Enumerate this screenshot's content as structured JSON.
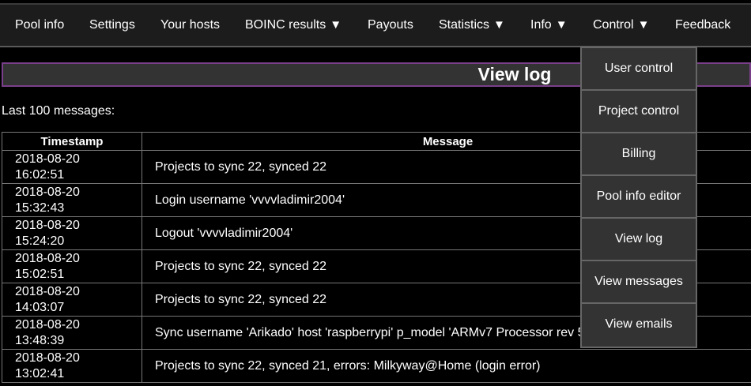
{
  "nav": {
    "items": [
      {
        "label": "Pool info",
        "arrow": ""
      },
      {
        "label": "Settings",
        "arrow": ""
      },
      {
        "label": "Your hosts",
        "arrow": ""
      },
      {
        "label": "BOINC results",
        "arrow": "▼"
      },
      {
        "label": "Payouts",
        "arrow": ""
      },
      {
        "label": "Statistics",
        "arrow": "▼"
      },
      {
        "label": "Info",
        "arrow": "▼"
      },
      {
        "label": "Control",
        "arrow": "▼"
      },
      {
        "label": "Feedback",
        "arrow": ""
      }
    ]
  },
  "page": {
    "title": "View log",
    "subtitle": "Last 100 messages:"
  },
  "table": {
    "headers": [
      "Timestamp",
      "Message"
    ],
    "rows": [
      {
        "date": "2018-08-20",
        "time": "16:02:51",
        "message": "Projects to sync 22, synced 22"
      },
      {
        "date": "2018-08-20",
        "time": "15:32:43",
        "message": "Login username 'vvvvladimir2004'"
      },
      {
        "date": "2018-08-20",
        "time": "15:24:20",
        "message": "Logout 'vvvvladimir2004'"
      },
      {
        "date": "2018-08-20",
        "time": "15:02:51",
        "message": "Projects to sync 22, synced 22"
      },
      {
        "date": "2018-08-20",
        "time": "14:03:07",
        "message": "Projects to sync 22, synced 22"
      },
      {
        "date": "2018-08-20",
        "time": "13:48:39",
        "message": "Sync username 'Arikado' host 'raspberrypi' p_model 'ARMv7 Processor rev 5"
      },
      {
        "date": "2018-08-20",
        "time": "13:02:41",
        "message": "Projects to sync 22, synced 21, errors: Milkyway@Home (login error)"
      }
    ]
  },
  "control_menu": {
    "items": [
      "User control",
      "Project control",
      "Billing",
      "Pool info editor",
      "View log",
      "View messages",
      "View emails"
    ]
  }
}
